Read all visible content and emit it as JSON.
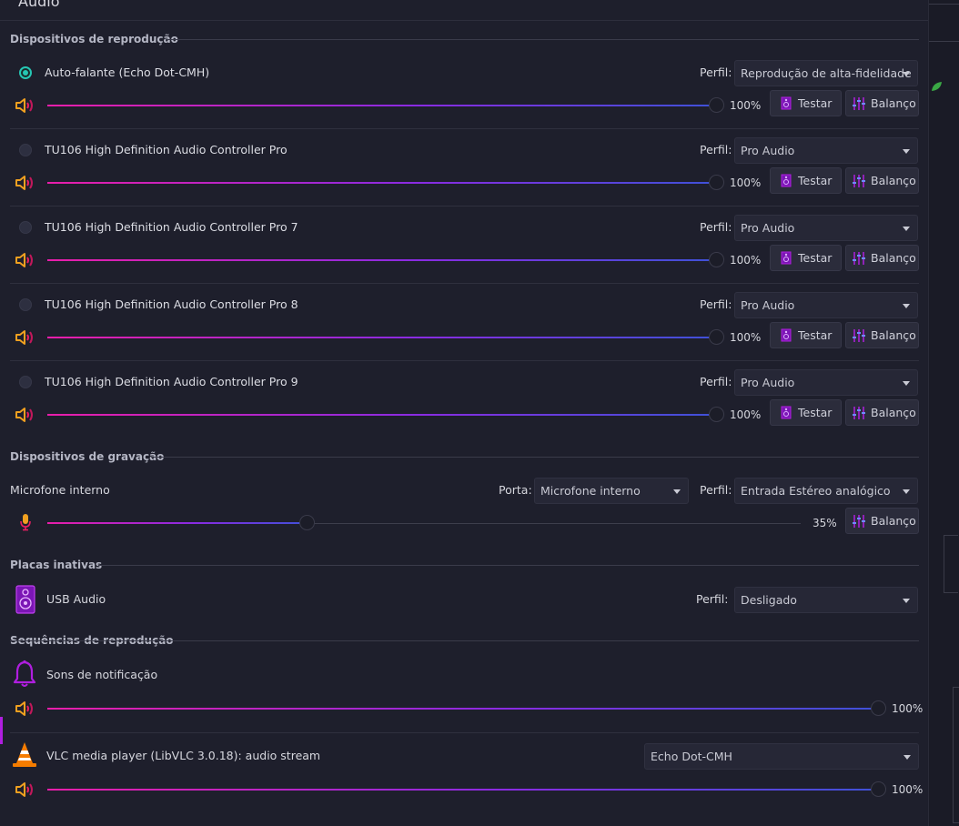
{
  "window": {
    "title": "Áudio"
  },
  "sections": {
    "playback": "Dispositivos de reprodução",
    "recording": "Dispositivos de gravação",
    "inactive": "Placas inativas",
    "streams": "Sequências de reprodução"
  },
  "labels": {
    "profile": "Perfil:",
    "port": "Porta:",
    "test": "Testar",
    "balance": "Balanço"
  },
  "playback_devices": [
    {
      "name": "Auto-falante (Echo Dot-CMH)",
      "selected": true,
      "profile": "Reprodução de alta-fidelidade",
      "volume": 100,
      "volume_text": "100%"
    },
    {
      "name": "TU106 High Definition Audio Controller Pro",
      "selected": false,
      "profile": "Pro Audio",
      "volume": 100,
      "volume_text": "100%"
    },
    {
      "name": "TU106 High Definition Audio Controller Pro 7",
      "selected": false,
      "profile": "Pro Audio",
      "volume": 100,
      "volume_text": "100%"
    },
    {
      "name": "TU106 High Definition Audio Controller Pro 8",
      "selected": false,
      "profile": "Pro Audio",
      "volume": 100,
      "volume_text": "100%"
    },
    {
      "name": "TU106 High Definition Audio Controller Pro 9",
      "selected": false,
      "profile": "Pro Audio",
      "volume": 100,
      "volume_text": "100%"
    }
  ],
  "recording_device": {
    "name": "Microfone interno",
    "port": "Microfone interno",
    "profile": "Entrada Estéreo analógico",
    "volume": 35,
    "volume_text": "35%"
  },
  "inactive_card": {
    "name": "USB Audio",
    "profile": "Desligado"
  },
  "streams": [
    {
      "name": "Sons de notificação",
      "icon": "bell-icon",
      "volume": 100,
      "volume_text": "100%"
    },
    {
      "name": "VLC media player (LibVLC 3.0.18): audio stream",
      "icon": "vlc-cone-icon",
      "output": "Echo Dot-CMH",
      "volume": 100,
      "volume_text": "100%"
    }
  ],
  "colors": {
    "accent_gradient": [
      "#e91eaa",
      "#8a2be2",
      "#3f51d8"
    ],
    "radio_selected": "#26c6b4",
    "speaker_icon": "#f0a020",
    "device_icon": "#b01ee0"
  }
}
